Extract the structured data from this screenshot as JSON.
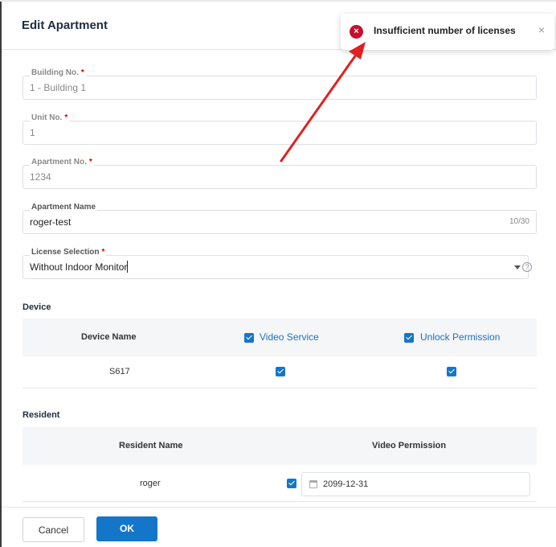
{
  "dialog": {
    "title": "Edit Apartment"
  },
  "form": {
    "building": {
      "label": "Building No.",
      "required": "*",
      "value": "1 - Building 1"
    },
    "unit": {
      "label": "Unit No.",
      "required": "*",
      "value": "1"
    },
    "apartment_no": {
      "label": "Apartment No.",
      "required": "*",
      "value": "1234"
    },
    "apartment_name": {
      "label": "Apartment Name",
      "value": "roger-test",
      "counter": "10/30"
    },
    "license": {
      "label": "License Selection",
      "required": "*",
      "value": "Without Indoor Monitor"
    }
  },
  "device": {
    "title": "Device",
    "columns": {
      "name": "Device Name",
      "video": "Video Service",
      "unlock": "Unlock Permission"
    },
    "rows": [
      {
        "name": "S617",
        "video": true,
        "unlock": true
      }
    ]
  },
  "resident": {
    "title": "Resident",
    "columns": {
      "name": "Resident Name",
      "permission": "Video Permission"
    },
    "rows": [
      {
        "name": "roger",
        "permission": true,
        "expiry": "2099-12-31"
      }
    ]
  },
  "footer": {
    "cancel_label": "Cancel",
    "ok_label": "OK"
  },
  "toast": {
    "message": "Insufficient number of licenses",
    "icon": "error-icon",
    "close_glyph": "×",
    "icon_glyph": "×"
  },
  "icons": {
    "help_glyph": "?"
  },
  "colors": {
    "primary": "#1476c9",
    "error": "#c8102e",
    "annotation_arrow": "#e02020"
  }
}
